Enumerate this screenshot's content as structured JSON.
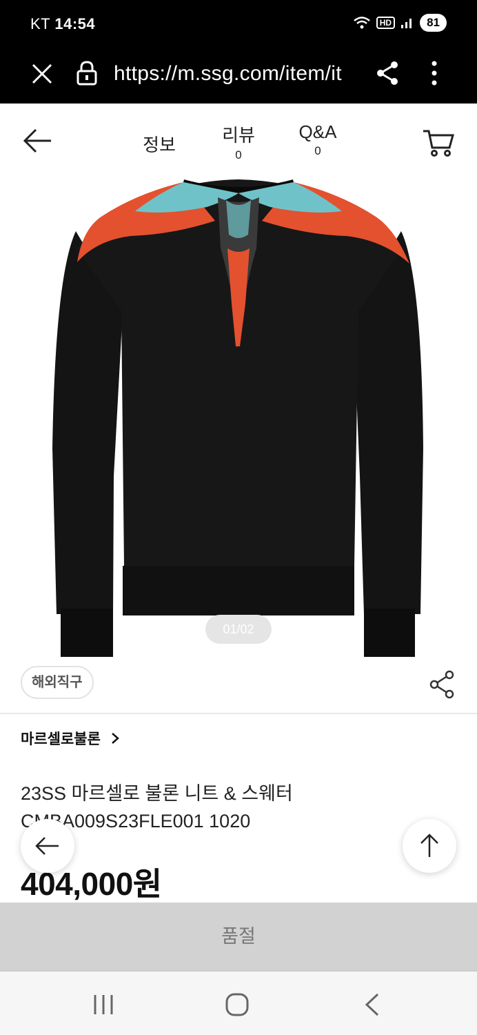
{
  "status_bar": {
    "carrier": "KT",
    "time": "14:54",
    "hd_label": "HD",
    "battery": "81"
  },
  "browser": {
    "url": "https://m.ssg.com/item/it"
  },
  "header": {
    "tabs": [
      {
        "label": "정보",
        "count": ""
      },
      {
        "label": "리뷰",
        "count": "0"
      },
      {
        "label": "Q&A",
        "count": "0"
      }
    ]
  },
  "gallery": {
    "indicator": "01/02"
  },
  "product": {
    "badge": "해외직구",
    "brand": "마르셀로불론",
    "title": "23SS 마르셀로 불론 니트 & 스웨터 CMBA009S23FLE001 1020",
    "price": "404,000원"
  },
  "buy_bar": {
    "label": "품절"
  },
  "colors": {
    "status_bg": "#000000",
    "buy_bar_bg": "#d2d2d2",
    "sweater": "#141414",
    "wing_orange": "#e4512f",
    "wing_teal": "#6fc3c8"
  }
}
